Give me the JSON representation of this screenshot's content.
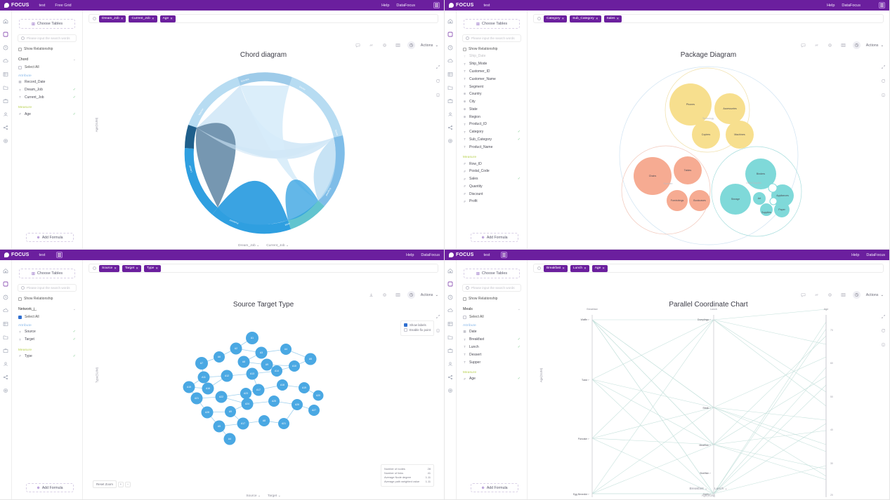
{
  "app": {
    "brand": "FOCUS",
    "nav": [
      "test",
      "Free Grid"
    ],
    "help": "Help",
    "account": "DataFocus",
    "nav_simple": [
      "test"
    ]
  },
  "common": {
    "choose_tables": "Choose Tables",
    "search_placeholder": "Please input the search words",
    "show_relationship": "Show Relationship",
    "select_all": "Select All",
    "attribute": "Attribute",
    "measure": "Measure",
    "add_formula": "Add Formula",
    "actions": "Actions"
  },
  "panels": [
    {
      "id": "chord",
      "title": "Chord diagram",
      "chips": [
        "Dream_Job",
        "Current_Job",
        "Age"
      ],
      "table_name": "Chord",
      "select_all_checked": false,
      "attributes": [
        {
          "label": "Record_Date",
          "icon": "calendar",
          "selected": false
        },
        {
          "label": "Dream_Job",
          "icon": "text",
          "selected": true
        },
        {
          "label": "Current_Job",
          "icon": "text",
          "selected": true
        }
      ],
      "measures": [
        {
          "label": "Age",
          "icon": "number",
          "selected": true
        }
      ],
      "footer": [
        "Dream_Job",
        "Current_Job"
      ],
      "yaxis_label": "Age(SUM)",
      "toolbar_active": "chart"
    },
    {
      "id": "package",
      "title": "Package Diagram",
      "chips": [
        "Category",
        "Sub_Category",
        "Sales"
      ],
      "table_name": "",
      "select_all_checked": false,
      "attributes": [
        {
          "label": "Ship_Mode",
          "icon": "text",
          "selected": false
        },
        {
          "label": "Customer_ID",
          "icon": "text",
          "selected": false
        },
        {
          "label": "Customer_Name",
          "icon": "text",
          "selected": false
        },
        {
          "label": "Segment",
          "icon": "text",
          "selected": false
        },
        {
          "label": "Country",
          "icon": "geo",
          "selected": false
        },
        {
          "label": "City",
          "icon": "geo",
          "selected": false
        },
        {
          "label": "State",
          "icon": "geo",
          "selected": false
        },
        {
          "label": "Region",
          "icon": "geo",
          "selected": false
        },
        {
          "label": "Product_ID",
          "icon": "text",
          "selected": false
        },
        {
          "label": "Category",
          "icon": "text",
          "selected": true
        },
        {
          "label": "Sub_Category",
          "icon": "text",
          "selected": true
        },
        {
          "label": "Product_Name",
          "icon": "text",
          "selected": false
        }
      ],
      "measures": [
        {
          "label": "Row_ID",
          "icon": "number",
          "selected": false
        },
        {
          "label": "Postal_Code",
          "icon": "number",
          "selected": false
        },
        {
          "label": "Sales",
          "icon": "number",
          "selected": true
        },
        {
          "label": "Quantity",
          "icon": "number",
          "selected": false
        },
        {
          "label": "Discount",
          "icon": "number",
          "selected": false
        },
        {
          "label": "Profit",
          "icon": "number",
          "selected": false
        }
      ],
      "footer": [],
      "toolbar_active": "chart"
    },
    {
      "id": "network",
      "title": "Source Target Type",
      "chips": [
        "Source",
        "Target",
        "Type"
      ],
      "table_name": "Network_j_",
      "select_all_checked": true,
      "attributes": [
        {
          "label": "Source",
          "icon": "text",
          "selected": true
        },
        {
          "label": "Target",
          "icon": "text",
          "selected": true
        }
      ],
      "measures": [
        {
          "label": "Type",
          "icon": "number",
          "selected": true
        }
      ],
      "footer": [
        "Source",
        "Target"
      ],
      "yaxis_label": "Type(SUM)",
      "toolbar_active": "chart",
      "options": [
        {
          "label": "Show labels",
          "checked": true
        },
        {
          "label": "Enable fix point",
          "checked": false
        }
      ],
      "reset_zoom": "Reset Zoom",
      "stats": [
        {
          "label": "Number of nodes",
          "value": "28"
        },
        {
          "label": "Number of links",
          "value": "41"
        },
        {
          "label": "Average Node degree",
          "value": "1.11"
        },
        {
          "label": "Average path weighted value",
          "value": "1.11"
        }
      ]
    },
    {
      "id": "parallel",
      "title": "Parallel Coordinate Chart",
      "chips": [
        "Breakfast",
        "Lunch",
        "Age"
      ],
      "table_name": "Meals",
      "select_all_checked": false,
      "attributes": [
        {
          "label": "Date",
          "icon": "calendar",
          "selected": false
        },
        {
          "label": "Breakfast",
          "icon": "text",
          "selected": true
        },
        {
          "label": "Lunch",
          "icon": "text",
          "selected": true
        },
        {
          "label": "Dessert",
          "icon": "text",
          "selected": false
        },
        {
          "label": "Supper",
          "icon": "text",
          "selected": false
        }
      ],
      "measures": [
        {
          "label": "Age",
          "icon": "number",
          "selected": true
        }
      ],
      "footer": [
        "Breakfast",
        "Lunch"
      ],
      "yaxis_label": "Age(SUM)",
      "toolbar_active": "chart"
    }
  ],
  "chart_data": [
    {
      "type": "chord",
      "title": "Chord diagram",
      "nodes": [
        {
          "name": "Teacher",
          "value": 20,
          "color": "#9ecbe9"
        },
        {
          "name": "Scientist",
          "value": 18,
          "color": "#b7dcf2"
        },
        {
          "name": "Doctor",
          "value": 16,
          "color": "#7fbde8"
        },
        {
          "name": "Nurse",
          "value": 10,
          "color": "#62c4cf"
        },
        {
          "name": "Engineer",
          "value": 22,
          "color": "#2f9fe0"
        },
        {
          "name": "Artist",
          "value": 12,
          "color": "#4aa8e3"
        },
        {
          "name": "Professor",
          "value": 14,
          "color": "#1f5f8b"
        },
        {
          "name": "Lawyer",
          "value": 10,
          "color": "#6f91ad"
        }
      ],
      "links": [
        {
          "source": "Teacher",
          "target": "Engineer",
          "value": 14
        },
        {
          "source": "Scientist",
          "target": "Artist",
          "value": 12
        },
        {
          "source": "Doctor",
          "target": "Nurse",
          "value": 9
        },
        {
          "source": "Professor",
          "target": "Lawyer",
          "value": 11
        },
        {
          "source": "Engineer",
          "target": "Artist",
          "value": 13
        },
        {
          "source": "Teacher",
          "target": "Scientist",
          "value": 8
        }
      ]
    },
    {
      "type": "circle-pack",
      "title": "Package Diagram",
      "groups": [
        {
          "name": "Technology",
          "color": "#f7df8e",
          "children": [
            {
              "name": "Phones",
              "value": 330007
            },
            {
              "name": "Accessories",
              "value": 167380
            },
            {
              "name": "Copiers",
              "value": 149528
            },
            {
              "name": "Machines",
              "value": 189239
            }
          ]
        },
        {
          "name": "Furniture",
          "color": "#f6ab92",
          "children": [
            {
              "name": "Chairs",
              "value": 328449
            },
            {
              "name": "Tables",
              "value": 206965
            },
            {
              "name": "Furnishings",
              "value": 91705
            },
            {
              "name": "Bookcases",
              "value": 114880
            }
          ]
        },
        {
          "name": "Office Supplies",
          "color": "#7fd9d9",
          "children": [
            {
              "name": "Binders",
              "value": 203413
            },
            {
              "name": "Storage",
              "value": 223844
            },
            {
              "name": "Appliances",
              "value": 107532
            },
            {
              "name": "Art",
              "value": 27119
            },
            {
              "name": "Paper",
              "value": 78479
            },
            {
              "name": "Supplies",
              "value": 46674
            }
          ]
        }
      ]
    },
    {
      "type": "network",
      "title": "Source Target Type",
      "node_count": 28,
      "link_count": 41,
      "node_color": "#4aa8e3",
      "nodes": [
        "A1",
        "A2",
        "A3",
        "A4",
        "A5",
        "A6",
        "A7",
        "A8",
        "A9",
        "A10",
        "A11",
        "A12",
        "A13",
        "A14",
        "A15",
        "A16",
        "A17",
        "A18",
        "A19",
        "A20",
        "A21",
        "A22",
        "A23",
        "A24",
        "A25",
        "A26",
        "A27",
        "A28"
      ]
    },
    {
      "type": "parallel",
      "title": "Parallel Coordinate Chart",
      "axes": [
        {
          "name": "Breakfast",
          "categories": [
            "Waffle",
            "Toast",
            "Pancake",
            "Egg Benedict"
          ]
        },
        {
          "name": "Lunch",
          "categories": [
            "Dumplings",
            "Steak",
            "MeatSau",
            "Shellfish",
            "Curry"
          ]
        },
        {
          "name": "Age",
          "ticks": [
            70,
            60,
            50,
            40,
            30,
            20
          ],
          "range": [
            20,
            75
          ]
        }
      ],
      "line_color": "#bcdcd6",
      "lines": [
        {
          "Breakfast": "Waffle",
          "Lunch": "Dumplings",
          "Age": 75
        },
        {
          "Breakfast": "Waffle",
          "Lunch": "Steak",
          "Age": 62
        },
        {
          "Breakfast": "Waffle",
          "Lunch": "MeatSau",
          "Age": 40
        },
        {
          "Breakfast": "Waffle",
          "Lunch": "Curry",
          "Age": 28
        },
        {
          "Breakfast": "Toast",
          "Lunch": "Dumplings",
          "Age": 52
        },
        {
          "Breakfast": "Toast",
          "Lunch": "Curry",
          "Age": 66
        },
        {
          "Breakfast": "Pancake",
          "Lunch": "Shellfish",
          "Age": 33
        },
        {
          "Breakfast": "Pancake",
          "Lunch": "Dumplings",
          "Age": 45
        },
        {
          "Breakfast": "Egg Benedict",
          "Lunch": "Curry",
          "Age": 70
        },
        {
          "Breakfast": "Egg Benedict",
          "Lunch": "MeatSau",
          "Age": 22
        }
      ]
    }
  ]
}
